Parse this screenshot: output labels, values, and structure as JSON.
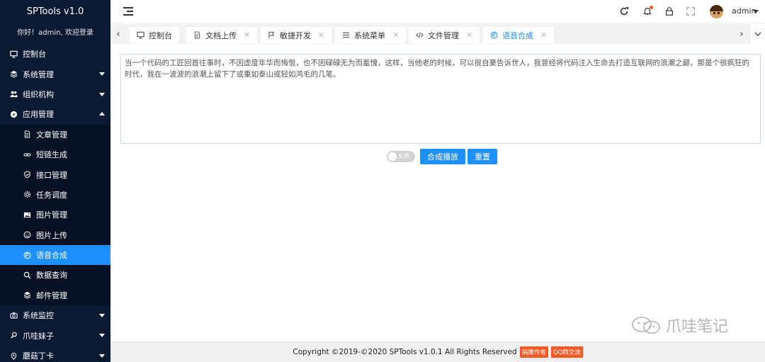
{
  "app": {
    "title": "SPTools v1.0",
    "welcome": "你好！admin, 欢迎登录"
  },
  "sidebar": {
    "items": [
      {
        "label": "控制台",
        "icon": "monitor-icon",
        "level": "top"
      },
      {
        "label": "系统管理",
        "icon": "layers-icon",
        "level": "top",
        "caret": "down"
      },
      {
        "label": "组织机构",
        "icon": "users-icon",
        "level": "top",
        "caret": "down"
      },
      {
        "label": "应用管理",
        "icon": "compass-icon",
        "level": "top",
        "caret": "up"
      },
      {
        "label": "文章管理",
        "icon": "file-icon",
        "level": "sub"
      },
      {
        "label": "短链生成",
        "icon": "link-icon",
        "level": "sub"
      },
      {
        "label": "接口管理",
        "icon": "shield-icon",
        "level": "sub"
      },
      {
        "label": "任务调度",
        "icon": "gear-icon",
        "level": "sub"
      },
      {
        "label": "图片管理",
        "icon": "image-icon",
        "level": "sub"
      },
      {
        "label": "图片上传",
        "icon": "smile-icon",
        "level": "sub"
      },
      {
        "label": "语音合成",
        "icon": "voice-icon",
        "level": "sub",
        "active": true
      },
      {
        "label": "数据查询",
        "icon": "search-icon",
        "level": "sub"
      },
      {
        "label": "邮件管理",
        "icon": "layers-icon",
        "level": "sub"
      },
      {
        "label": "系统监控",
        "icon": "camera-icon",
        "level": "top",
        "caret": "down"
      },
      {
        "label": "爪哇妹子",
        "icon": "key-icon",
        "level": "top",
        "caret": "down"
      },
      {
        "label": "蘑菇丁卡",
        "icon": "pin-icon",
        "level": "top",
        "caret": "down"
      }
    ]
  },
  "header": {
    "username": "admin"
  },
  "tabs": [
    {
      "label": "控制台",
      "icon": "monitor-icon",
      "closable": false
    },
    {
      "label": "文档上传",
      "icon": "file-icon",
      "closable": true
    },
    {
      "label": "敏捷开发",
      "icon": "flag-icon",
      "closable": true
    },
    {
      "label": "系统菜单",
      "icon": "list-icon",
      "closable": true
    },
    {
      "label": "文件管理",
      "icon": "code-icon",
      "closable": true
    },
    {
      "label": "语音合成",
      "icon": "voice-icon",
      "closable": true,
      "active": true
    }
  ],
  "main": {
    "text": "当一个代码的工匠回首往事时，不因虚度年华而悔恨，也不因碌碌无为而羞愧，这样，当他老的时候，可以很自豪告诉世人，我曾经将代码注入生命去打造互联网的浪潮之巅，那是个很疯狂的时代，我在一波波的浪潮上留下了或重如泰山或轻如鸿毛的几笔。",
    "voice_toggle_label": "女声",
    "voice_toggle_on": false,
    "play_button": "合成播放",
    "reset_button": "重置"
  },
  "footer": {
    "copyright": "Copyright ©2019-©2020 SPTools v1.0.1 All Rights Reserved",
    "donate_label": "捐赠作者",
    "qq_label": "QQ群交流"
  },
  "watermark": {
    "text": "爪哇笔记"
  },
  "colors": {
    "sidebar_bg": "#0a1a33",
    "accent": "#1e90ff",
    "badge": "#ff5722"
  }
}
